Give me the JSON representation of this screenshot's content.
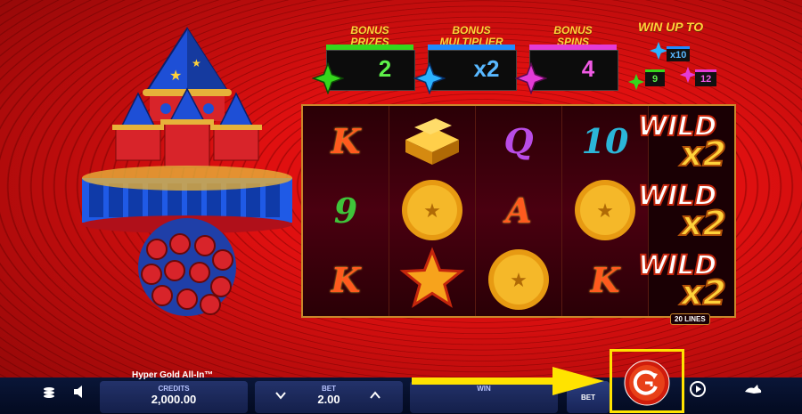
{
  "bonus_panels": [
    {
      "title_line1": "BONUS",
      "title_line2": "PRIZES",
      "value": "2",
      "accent": "#35d61c"
    },
    {
      "title_line1": "BONUS",
      "title_line2": "MULTIPLIER",
      "value": "x2",
      "accent": "#1f8bff"
    },
    {
      "title_line1": "BONUS",
      "title_line2": "SPINS",
      "value": "4",
      "accent": "#e43bd6"
    }
  ],
  "win_up_to": {
    "label": "WIN UP TO",
    "multiplier": "x10",
    "prizes": "9",
    "spins": "12"
  },
  "reels": [
    [
      "K",
      "9",
      "K"
    ],
    [
      "gold-bars",
      "gold-coin",
      "gold-star"
    ],
    [
      "Q",
      "A",
      "gold-coin"
    ],
    [
      "10",
      "gold-coin",
      "K"
    ]
  ],
  "wild_symbols": [
    {
      "word": "WILD",
      "mult": "x2"
    },
    {
      "word": "WILD",
      "mult": "x2"
    },
    {
      "word": "WILD",
      "mult": "x2"
    }
  ],
  "lines_badge": "20 LINES",
  "footer": {
    "game_title": "Hyper Gold All-In™",
    "credits_label": "CREDITS",
    "credits_value": "2,000.00",
    "bet_label": "BET",
    "bet_value": "2.00",
    "win_label": "WIN",
    "max_bet_label": "BET"
  },
  "colors": {
    "accent_gold": "#ffd23a",
    "highlight_box": "#ffe300",
    "spin_button": "#e02a10"
  }
}
